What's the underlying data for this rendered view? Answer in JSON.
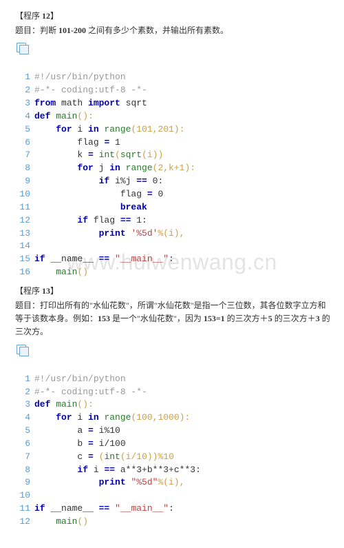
{
  "watermark": "www.huiwenwang.cn",
  "program12": {
    "title": "【程序 12】",
    "desc": "题目：判断 101-200 之间有多少个素数，并输出所有素数。"
  },
  "code12": {
    "l1t": "#!/usr/bin/python",
    "l2t": "#-*- coding:utf-8 -*-",
    "l3a": "from",
    "l3b": " math ",
    "l3c": "import",
    "l3d": " sqrt",
    "l4a": "def",
    "l4b": " main",
    "l4c": "():",
    "l5a": "for",
    "l5b": " i ",
    "l5c": "in",
    "l5d": " range",
    "l5e": "(101,201):",
    "l6a": "flag ",
    "l6b": "=",
    "l6c": " 1",
    "l7a": "k ",
    "l7b": "=",
    "l7c": " int",
    "l7d": "(",
    "l7e": "sqrt",
    "l7f": "(i))",
    "l8a": "for",
    "l8b": " j ",
    "l8c": "in",
    "l8d": " range",
    "l8e": "(2,k+1):",
    "l9a": "if",
    "l9b": " i%j ",
    "l9c": "==",
    "l9d": " 0:",
    "l10a": "flag ",
    "l10b": "=",
    "l10c": " 0",
    "l11t": "break",
    "l12a": "if",
    "l12b": " flag ",
    "l12c": "==",
    "l12d": " 1:",
    "l13a": "print",
    "l13b": " '%5d'",
    "l13c": "%(i),",
    "l15a": "if",
    "l15b": " __name__ ",
    "l15c": "==",
    "l15d": " \"__main__\"",
    "l15e": ":",
    "l16a": "main",
    "l16b": "()"
  },
  "program13": {
    "title": "【程序 13】",
    "desc": "题目：打印出所有的\"水仙花数\"，所谓\"水仙花数\"是指一个三位数，其各位数字立方和等于该数本身。例如：153 是一个\"水仙花数\"，因为 153=1 的三次方＋5 的三次方＋3 的三次方。"
  },
  "code13": {
    "l1t": "#!/usr/bin/python",
    "l2t": "#-*- coding:utf-8 -*-",
    "l3a": "def",
    "l3b": " main",
    "l3c": "():",
    "l4a": "for",
    "l4b": " i ",
    "l4c": "in",
    "l4d": " range",
    "l4e": "(100,1000):",
    "l5a": "a ",
    "l5b": "=",
    "l5c": " i%10",
    "l6a": "b ",
    "l6b": "=",
    "l6c": " i/100",
    "l7a": "c ",
    "l7b": "=",
    "l7c": " (",
    "l7d": "int",
    "l7e": "(i/10))%10",
    "l8a": "if",
    "l8b": " i ",
    "l8c": "==",
    "l8d": " a**3+b**3+c**3:",
    "l9a": "print",
    "l9b": " \"%5d\"",
    "l9c": "%(i),",
    "l11a": "if",
    "l11b": " __name__ ",
    "l11c": "==",
    "l11d": " \"__main__\"",
    "l11e": ":",
    "l12a": "main",
    "l12b": "()"
  }
}
